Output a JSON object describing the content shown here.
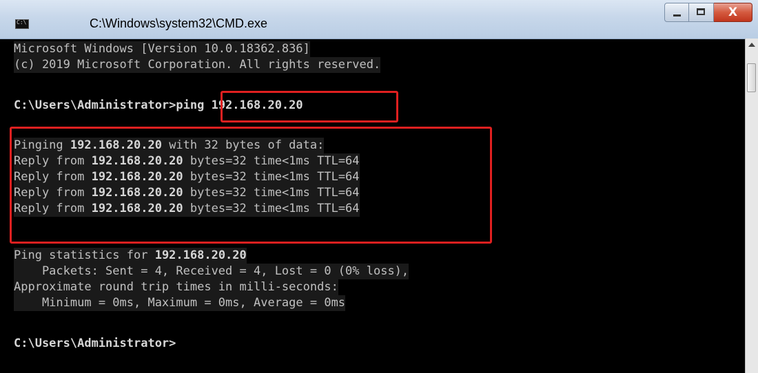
{
  "window": {
    "title": "C:\\Windows\\system32\\CMD.exe",
    "buttons": {
      "minimize": "–",
      "maximize": "□",
      "close": "X"
    }
  },
  "console": {
    "line1": "Microsoft Windows [Version 10.0.18362.836]",
    "line2": "(c) 2019 Microsoft Corporation. All rights reserved.",
    "prompt1": "C:\\Users\\Administrator>",
    "command1": "ping 192.168.20.20",
    "ping_header_prefix": "Pinging ",
    "ping_ip": "192.168.20.20",
    "ping_header_suffix": " with 32 bytes of data:",
    "reply_prefix": "Reply from ",
    "reply_ip": "192.168.20.20",
    "reply_suffix": " bytes=32 time<1ms TTL=64",
    "stats_prefix": "Ping statistics for ",
    "stats_ip": "192.168.20.20",
    "packets": "    Packets: Sent = 4, Received = 4, Lost = 0 (0% loss),",
    "approx": "Approximate round trip times in milli-seconds:",
    "times": "    Minimum = 0ms, Maximum = 0ms, Average = 0ms",
    "prompt2": "C:\\Users\\Administrator>"
  },
  "colors": {
    "background": "#000000",
    "text": "#c0c0c0",
    "highlight": "#e02020"
  }
}
